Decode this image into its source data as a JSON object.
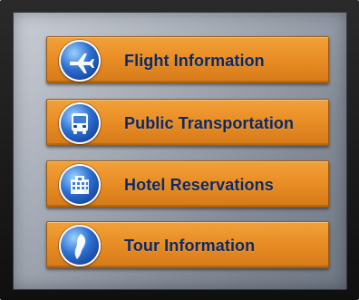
{
  "menu": {
    "items": [
      {
        "label": "Flight Information",
        "icon": "airplane-icon"
      },
      {
        "label": "Public Transportation",
        "icon": "bus-icon"
      },
      {
        "label": "Hotel Reservations",
        "icon": "hotel-icon"
      },
      {
        "label": "Tour Information",
        "icon": "map-icon"
      }
    ]
  },
  "colors": {
    "button_orange": "#ea8e26",
    "label_navy": "#0b2a66",
    "icon_blue": "#2c6fd0",
    "screen_gray": "#a7adb7",
    "bezel_black": "#141414"
  }
}
